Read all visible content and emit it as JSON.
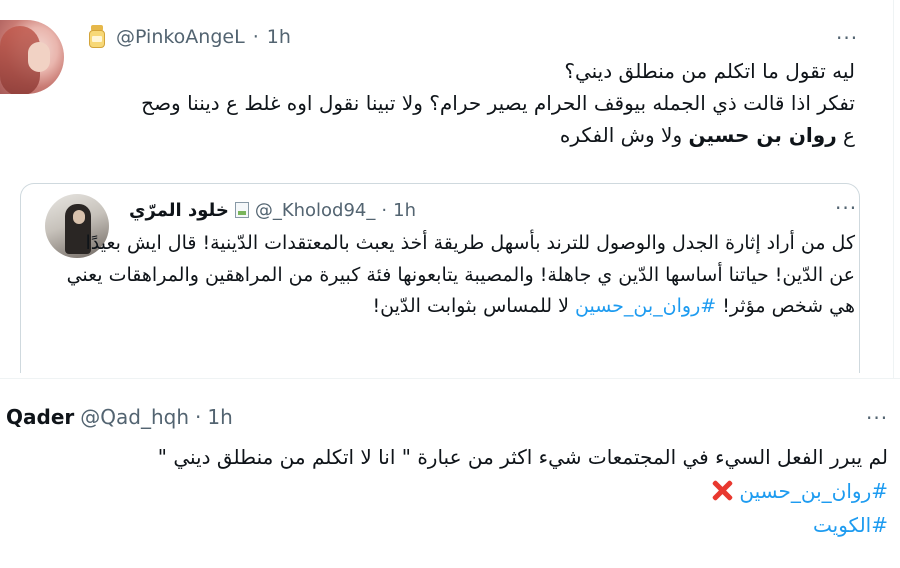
{
  "tweet1": {
    "handle": "@PinkoAngeL",
    "separator": "·",
    "time": "1h",
    "more": "···",
    "lines": [
      "ليه تقول ما اتكلم من منطلق ديني؟",
      "تفكر اذا قالت ذي الجمله بيوقف الحرام يصير حرام؟ ولا تبينا نقول اوه غلط ع ديننا وصح"
    ],
    "line3_prefix": "ع ",
    "line3_bold": "روان بن حسين",
    "line3_suffix": " ولا وش الفكره"
  },
  "quote": {
    "name": "خلود المرّي",
    "handle": "@_Kholod94_",
    "separator": "·",
    "time": "1h",
    "more": "···",
    "text": "كل من أراد إثارة الجدل والوصول للترند بأسهل طريقة أخذ يعبث بالمعتقدات الدّينية! قال ايش بعيدًا عن الدّين! حياتنا أساسها الدّين ي جاهلة! والمصيبة يتابعونها فئة كبيرة من المراهقين والمراهقات يعني هي شخص مؤثر! ",
    "hashtag": "#روان_بن_حسين",
    "text_end": " لا للمساس بثوابت الدّين!"
  },
  "tweet2": {
    "name": "Qader",
    "handle": "@Qad_hqh",
    "separator": "·",
    "time": "1h",
    "more": "···",
    "line1": "لم يبرر الفعل السيء في المجتمعات شيء اكثر من عبارة \" انا لا اتكلم من منطلق ديني \"",
    "hashtag1": "#روان_بن_حسين",
    "hashtag2": "#الكويت"
  },
  "colors": {
    "hashtag": "#1d9bf0",
    "text": "#0f1419",
    "muted": "#536471",
    "border": "#cfd9de",
    "cross": "#e8382f"
  }
}
